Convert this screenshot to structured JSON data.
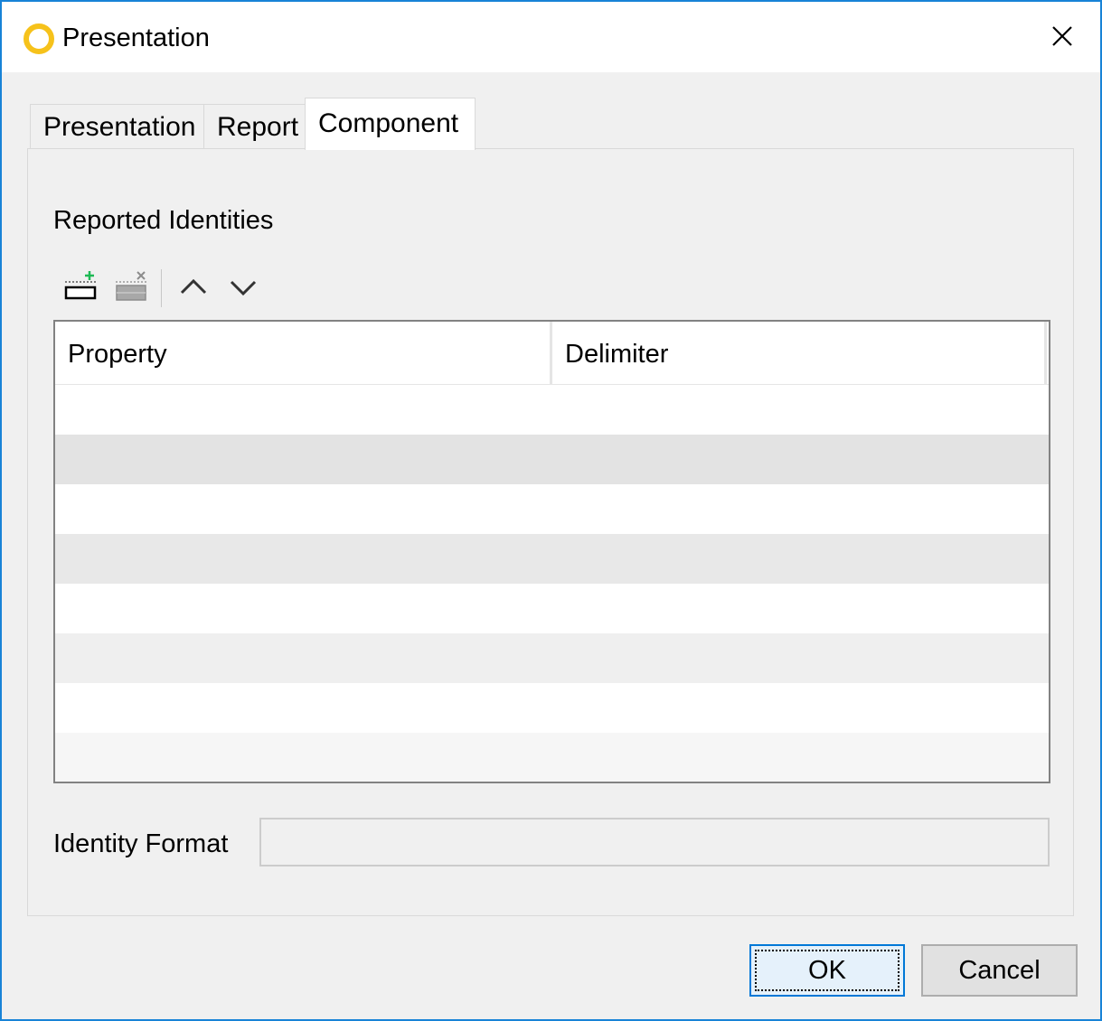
{
  "window": {
    "title": "Presentation",
    "accent_color": "#1883d7",
    "icons": {
      "app": "ring-icon",
      "close": "close-icon"
    }
  },
  "tabs": [
    {
      "label": "Presentation",
      "active": false
    },
    {
      "label": "Report",
      "active": false
    },
    {
      "label": "Component",
      "active": true
    }
  ],
  "component": {
    "section_label": "Reported Identities",
    "toolbar": [
      {
        "name": "add-row-icon",
        "enabled": true
      },
      {
        "name": "remove-row-icon",
        "enabled": false
      },
      {
        "name": "move-up-icon",
        "enabled": true
      },
      {
        "name": "move-down-icon",
        "enabled": true
      }
    ],
    "table": {
      "columns": [
        "Property",
        "Delimiter"
      ],
      "rows": [],
      "stripe_color": "#e6e6e6"
    },
    "identity_format": {
      "label": "Identity Format",
      "value": "",
      "placeholder": ""
    }
  },
  "buttons": {
    "ok": "OK",
    "cancel": "Cancel"
  }
}
